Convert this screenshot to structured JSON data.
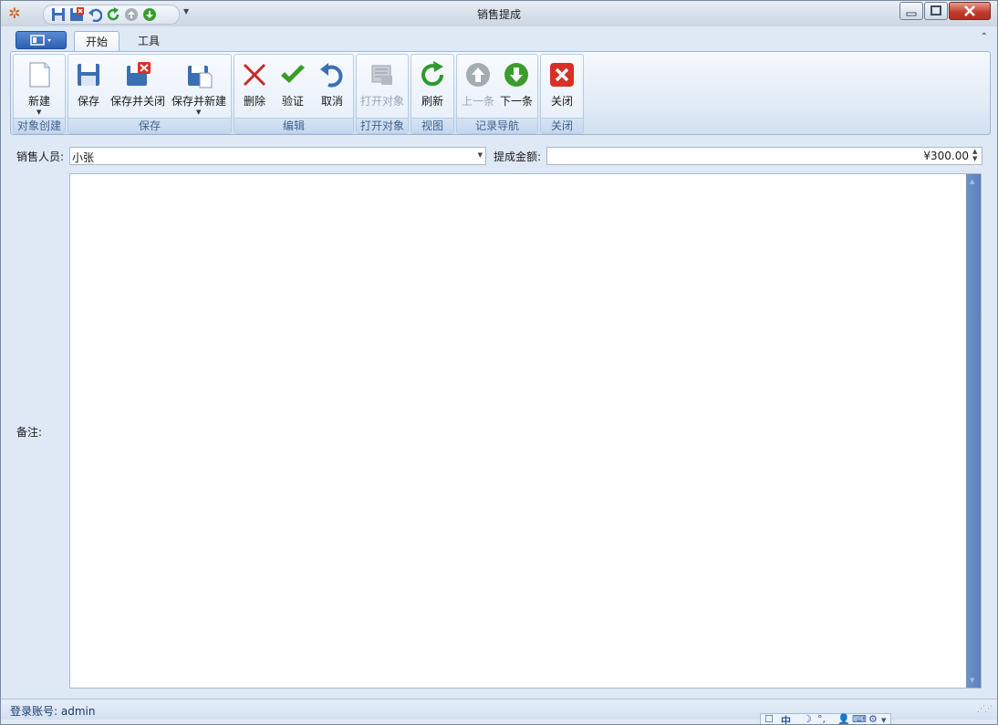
{
  "window": {
    "title": "销售提成"
  },
  "ribbon": {
    "tabs": [
      {
        "label": "开始"
      },
      {
        "label": "工具"
      }
    ],
    "groups": [
      {
        "label": "对象创建",
        "buttons": [
          {
            "label": "新建"
          }
        ]
      },
      {
        "label": "保存",
        "buttons": [
          {
            "label": "保存"
          },
          {
            "label": "保存并关闭"
          },
          {
            "label": "保存并新建"
          }
        ]
      },
      {
        "label": "编辑",
        "buttons": [
          {
            "label": "删除"
          },
          {
            "label": "验证"
          },
          {
            "label": "取消"
          }
        ]
      },
      {
        "label": "打开对象",
        "buttons": [
          {
            "label": "打开对象"
          }
        ]
      },
      {
        "label": "视图",
        "buttons": [
          {
            "label": "刷新"
          }
        ]
      },
      {
        "label": "记录导航",
        "buttons": [
          {
            "label": "上一条"
          },
          {
            "label": "下一条"
          }
        ]
      },
      {
        "label": "关闭",
        "buttons": [
          {
            "label": "关闭"
          }
        ]
      }
    ]
  },
  "form": {
    "salesperson_label": "销售人员:",
    "salesperson_value": "小张",
    "amount_label": "提成金额:",
    "amount_value": "¥300.00",
    "notes_label": "备注:"
  },
  "statusbar": {
    "account_text": "登录账号: admin"
  },
  "ime": {
    "text": "中"
  },
  "colors": {
    "accent": "#2c5fb3",
    "ribbon_bg": "#dfe9f6",
    "scrollbar": "#5881bd",
    "close_red": "#d93025",
    "check_green": "#3a9c2a"
  }
}
